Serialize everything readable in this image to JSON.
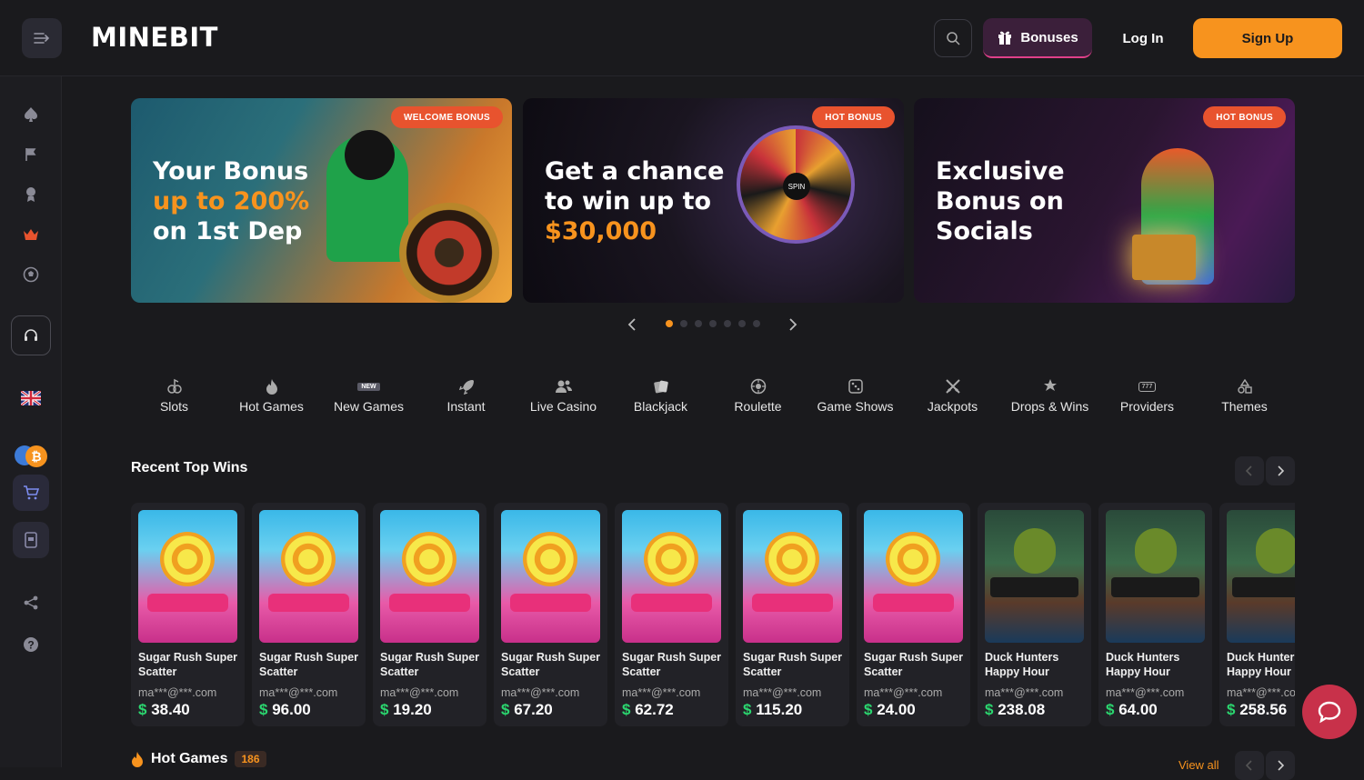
{
  "header": {
    "logo_text": "MINEBIT",
    "bonuses_label": "Bonuses",
    "login_label": "Log In",
    "signup_label": "Sign Up"
  },
  "sidebar": {
    "items": [
      {
        "icon": "spade-icon"
      },
      {
        "icon": "flag-icon"
      },
      {
        "icon": "trophy-icon"
      },
      {
        "icon": "crown-icon"
      },
      {
        "icon": "football-icon"
      },
      {
        "icon": "headset-icon"
      },
      {
        "icon": "uk-flag-icon"
      },
      {
        "icon": "crypto-icon"
      },
      {
        "icon": "cart-icon"
      },
      {
        "icon": "wallet-icon"
      },
      {
        "icon": "share-icon"
      },
      {
        "icon": "help-icon"
      }
    ]
  },
  "banners": [
    {
      "tag": "WELCOME BONUS",
      "line1": "Your Bonus",
      "line2": "up to 200%",
      "line3": "on 1st Dep"
    },
    {
      "tag": "HOT BONUS",
      "line1": "Get a chance",
      "line2": "to win up to",
      "line3": "$30,000"
    },
    {
      "tag": "HOT BONUS",
      "line1": "Exclusive",
      "line2": "Bonus on",
      "line3": "Socials"
    }
  ],
  "carousel": {
    "active_index": 0,
    "total": 7
  },
  "categories": [
    {
      "label": "Slots",
      "icon": "slots-icon"
    },
    {
      "label": "Hot Games",
      "icon": "fire-icon"
    },
    {
      "label": "New Games",
      "icon": "new-badge-icon",
      "badge": "NEW"
    },
    {
      "label": "Instant",
      "icon": "rocket-icon"
    },
    {
      "label": "Live Casino",
      "icon": "people-icon"
    },
    {
      "label": "Blackjack",
      "icon": "cards-icon"
    },
    {
      "label": "Roulette",
      "icon": "roulette-icon"
    },
    {
      "label": "Game Shows",
      "icon": "dice-icon"
    },
    {
      "label": "Jackpots",
      "icon": "swords-icon"
    },
    {
      "label": "Drops & Wins",
      "icon": "drops-icon"
    },
    {
      "label": "Providers",
      "icon": "providers-icon",
      "badge": "777"
    },
    {
      "label": "Themes",
      "icon": "shapes-icon"
    }
  ],
  "recent_wins": {
    "title": "Recent Top Wins",
    "items": [
      {
        "game_line1": "Sugar Rush Super",
        "game_line2": "Scatter",
        "user": "ma***@***.com",
        "currency": "$",
        "amount": "38.40",
        "theme": "sugar"
      },
      {
        "game_line1": "Sugar Rush Super",
        "game_line2": "Scatter",
        "user": "ma***@***.com",
        "currency": "$",
        "amount": "96.00",
        "theme": "sugar"
      },
      {
        "game_line1": "Sugar Rush Super",
        "game_line2": "Scatter",
        "user": "ma***@***.com",
        "currency": "$",
        "amount": "19.20",
        "theme": "sugar"
      },
      {
        "game_line1": "Sugar Rush Super",
        "game_line2": "Scatter",
        "user": "ma***@***.com",
        "currency": "$",
        "amount": "67.20",
        "theme": "sugar"
      },
      {
        "game_line1": "Sugar Rush Super",
        "game_line2": "Scatter",
        "user": "ma***@***.com",
        "currency": "$",
        "amount": "62.72",
        "theme": "sugar"
      },
      {
        "game_line1": "Sugar Rush Super",
        "game_line2": "Scatter",
        "user": "ma***@***.com",
        "currency": "$",
        "amount": "115.20",
        "theme": "sugar"
      },
      {
        "game_line1": "Sugar Rush Super",
        "game_line2": "Scatter",
        "user": "ma***@***.com",
        "currency": "$",
        "amount": "24.00",
        "theme": "sugar"
      },
      {
        "game_line1": "Duck Hunters",
        "game_line2": "Happy Hour",
        "user": "ma***@***.com",
        "currency": "$",
        "amount": "238.08",
        "theme": "duck"
      },
      {
        "game_line1": "Duck Hunters",
        "game_line2": "Happy Hour",
        "user": "ma***@***.com",
        "currency": "$",
        "amount": "64.00",
        "theme": "duck"
      },
      {
        "game_line1": "Duck Hunters",
        "game_line2": "Happy Hour",
        "user": "ma***@***.com",
        "currency": "$",
        "amount": "258.56",
        "theme": "duck"
      }
    ]
  },
  "hot_games": {
    "title": "Hot Games",
    "count": "186",
    "view_all": "View all"
  },
  "colors": {
    "accent": "#f7931e",
    "win_green": "#2bd66f",
    "tag": "#e8532e",
    "chat": "#c8314a"
  }
}
